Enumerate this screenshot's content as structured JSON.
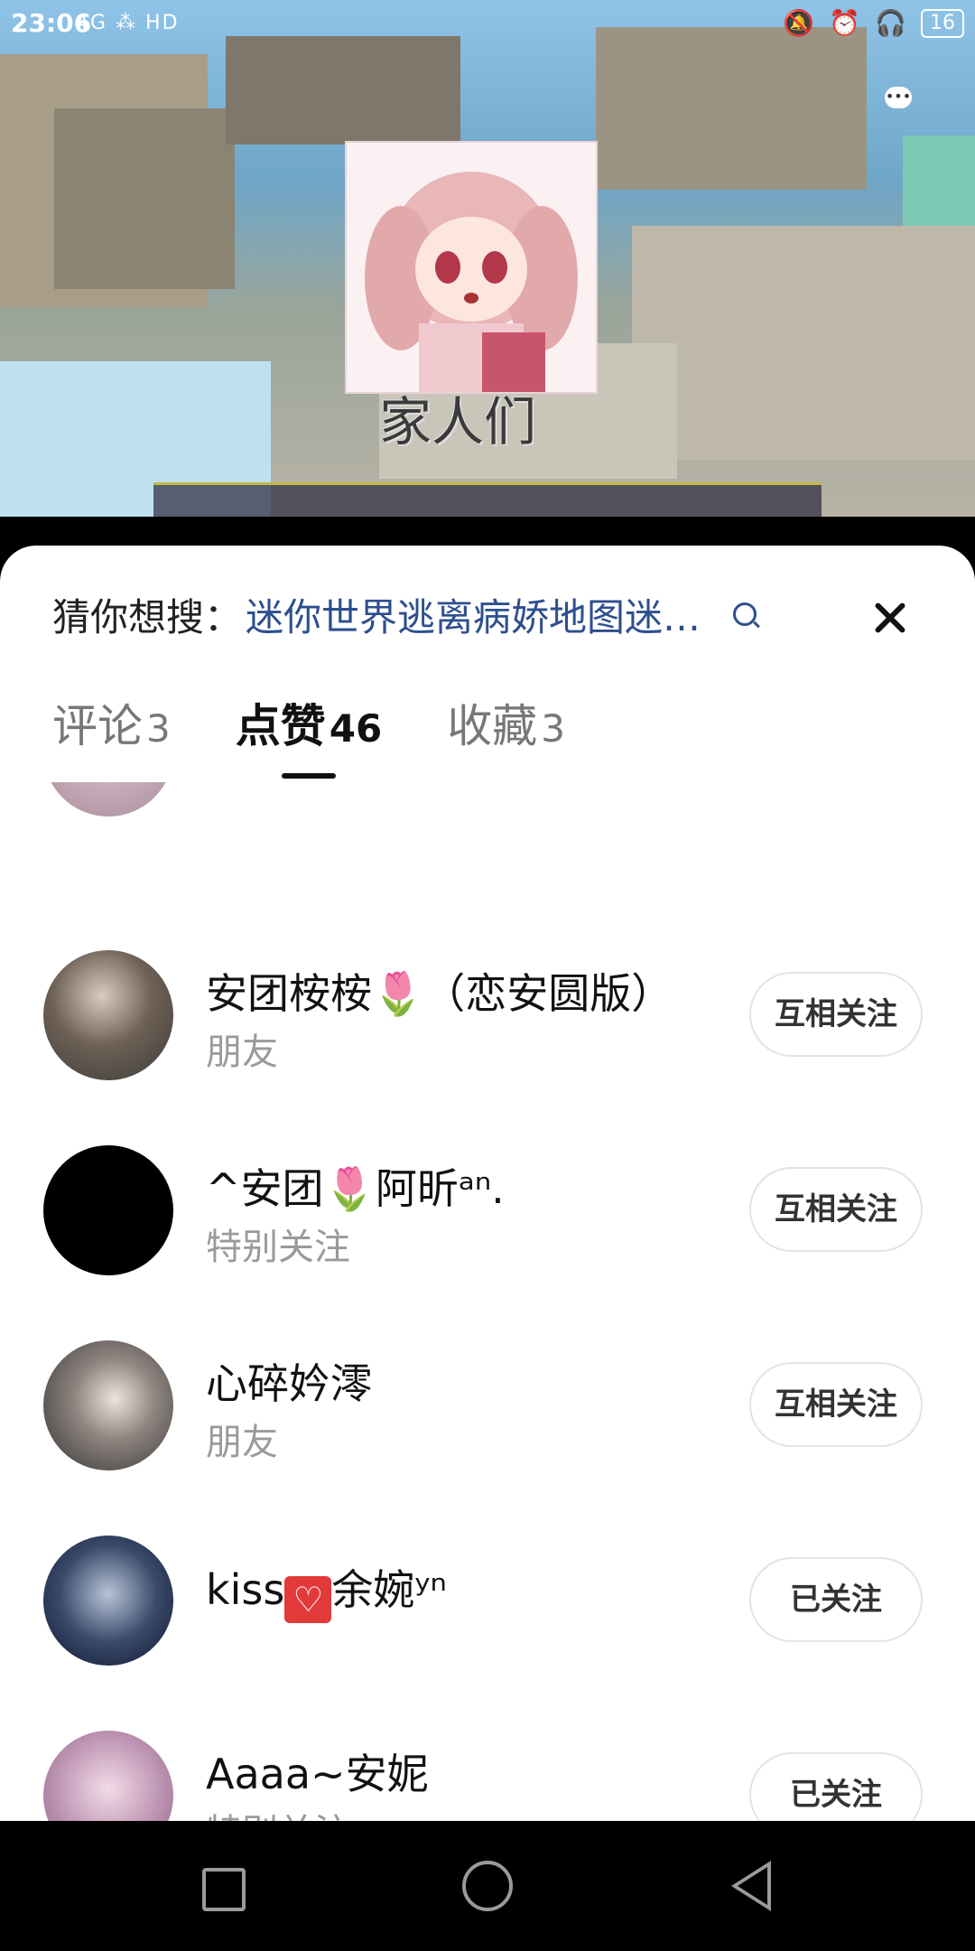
{
  "status_bar": {
    "time": "23:06",
    "left_icons": "4G  ⁂  HD",
    "battery": "16"
  },
  "video": {
    "sticker_caption": "家人们"
  },
  "sheet": {
    "search_hint_label": "猜你想搜：",
    "search_hint_query": "迷你世界逃离病娇地图迷…",
    "tabs": [
      {
        "label": "评论",
        "count": "3"
      },
      {
        "label": "点赞",
        "count": "46"
      },
      {
        "label": "收藏",
        "count": "3"
      }
    ],
    "likes": [
      {
        "name": "安团桉桉🌷（恋安圆版）",
        "sub": "朋友",
        "button": "互相关注"
      },
      {
        "name": "^安团🌷阿昕ᵃⁿ.",
        "sub": "特别关注",
        "button": "互相关注"
      },
      {
        "name": "心碎妗澪",
        "sub": "朋友",
        "button": "互相关注"
      },
      {
        "name_prefix": "kiss",
        "name_suffix": "余婉ʸⁿ",
        "sub": "",
        "button": "已关注"
      },
      {
        "name": "Aaaa~安妮",
        "sub": "特别关注",
        "button": "已关注"
      }
    ]
  }
}
